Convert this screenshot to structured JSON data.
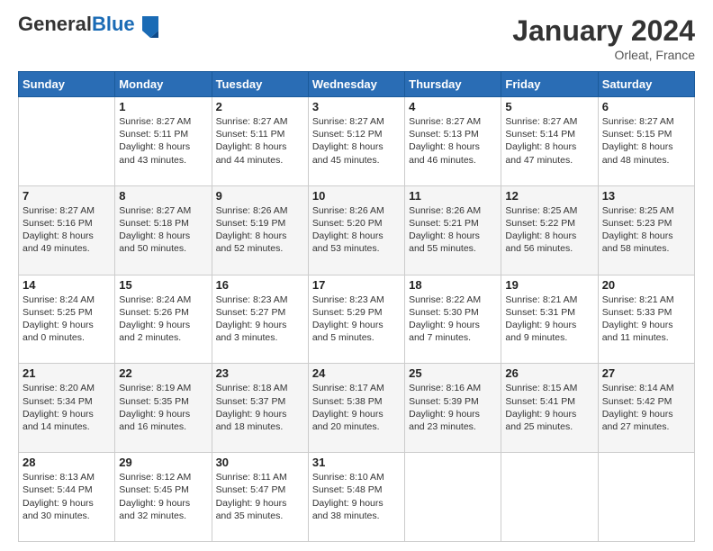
{
  "header": {
    "logo_general": "General",
    "logo_blue": "Blue",
    "month_title": "January 2024",
    "location": "Orleat, France"
  },
  "days_of_week": [
    "Sunday",
    "Monday",
    "Tuesday",
    "Wednesday",
    "Thursday",
    "Friday",
    "Saturday"
  ],
  "weeks": [
    [
      {
        "day": "",
        "text": ""
      },
      {
        "day": "1",
        "text": "Sunrise: 8:27 AM\nSunset: 5:11 PM\nDaylight: 8 hours\nand 43 minutes."
      },
      {
        "day": "2",
        "text": "Sunrise: 8:27 AM\nSunset: 5:11 PM\nDaylight: 8 hours\nand 44 minutes."
      },
      {
        "day": "3",
        "text": "Sunrise: 8:27 AM\nSunset: 5:12 PM\nDaylight: 8 hours\nand 45 minutes."
      },
      {
        "day": "4",
        "text": "Sunrise: 8:27 AM\nSunset: 5:13 PM\nDaylight: 8 hours\nand 46 minutes."
      },
      {
        "day": "5",
        "text": "Sunrise: 8:27 AM\nSunset: 5:14 PM\nDaylight: 8 hours\nand 47 minutes."
      },
      {
        "day": "6",
        "text": "Sunrise: 8:27 AM\nSunset: 5:15 PM\nDaylight: 8 hours\nand 48 minutes."
      }
    ],
    [
      {
        "day": "7",
        "text": "Sunrise: 8:27 AM\nSunset: 5:16 PM\nDaylight: 8 hours\nand 49 minutes."
      },
      {
        "day": "8",
        "text": "Sunrise: 8:27 AM\nSunset: 5:18 PM\nDaylight: 8 hours\nand 50 minutes."
      },
      {
        "day": "9",
        "text": "Sunrise: 8:26 AM\nSunset: 5:19 PM\nDaylight: 8 hours\nand 52 minutes."
      },
      {
        "day": "10",
        "text": "Sunrise: 8:26 AM\nSunset: 5:20 PM\nDaylight: 8 hours\nand 53 minutes."
      },
      {
        "day": "11",
        "text": "Sunrise: 8:26 AM\nSunset: 5:21 PM\nDaylight: 8 hours\nand 55 minutes."
      },
      {
        "day": "12",
        "text": "Sunrise: 8:25 AM\nSunset: 5:22 PM\nDaylight: 8 hours\nand 56 minutes."
      },
      {
        "day": "13",
        "text": "Sunrise: 8:25 AM\nSunset: 5:23 PM\nDaylight: 8 hours\nand 58 minutes."
      }
    ],
    [
      {
        "day": "14",
        "text": "Sunrise: 8:24 AM\nSunset: 5:25 PM\nDaylight: 9 hours\nand 0 minutes."
      },
      {
        "day": "15",
        "text": "Sunrise: 8:24 AM\nSunset: 5:26 PM\nDaylight: 9 hours\nand 2 minutes."
      },
      {
        "day": "16",
        "text": "Sunrise: 8:23 AM\nSunset: 5:27 PM\nDaylight: 9 hours\nand 3 minutes."
      },
      {
        "day": "17",
        "text": "Sunrise: 8:23 AM\nSunset: 5:29 PM\nDaylight: 9 hours\nand 5 minutes."
      },
      {
        "day": "18",
        "text": "Sunrise: 8:22 AM\nSunset: 5:30 PM\nDaylight: 9 hours\nand 7 minutes."
      },
      {
        "day": "19",
        "text": "Sunrise: 8:21 AM\nSunset: 5:31 PM\nDaylight: 9 hours\nand 9 minutes."
      },
      {
        "day": "20",
        "text": "Sunrise: 8:21 AM\nSunset: 5:33 PM\nDaylight: 9 hours\nand 11 minutes."
      }
    ],
    [
      {
        "day": "21",
        "text": "Sunrise: 8:20 AM\nSunset: 5:34 PM\nDaylight: 9 hours\nand 14 minutes."
      },
      {
        "day": "22",
        "text": "Sunrise: 8:19 AM\nSunset: 5:35 PM\nDaylight: 9 hours\nand 16 minutes."
      },
      {
        "day": "23",
        "text": "Sunrise: 8:18 AM\nSunset: 5:37 PM\nDaylight: 9 hours\nand 18 minutes."
      },
      {
        "day": "24",
        "text": "Sunrise: 8:17 AM\nSunset: 5:38 PM\nDaylight: 9 hours\nand 20 minutes."
      },
      {
        "day": "25",
        "text": "Sunrise: 8:16 AM\nSunset: 5:39 PM\nDaylight: 9 hours\nand 23 minutes."
      },
      {
        "day": "26",
        "text": "Sunrise: 8:15 AM\nSunset: 5:41 PM\nDaylight: 9 hours\nand 25 minutes."
      },
      {
        "day": "27",
        "text": "Sunrise: 8:14 AM\nSunset: 5:42 PM\nDaylight: 9 hours\nand 27 minutes."
      }
    ],
    [
      {
        "day": "28",
        "text": "Sunrise: 8:13 AM\nSunset: 5:44 PM\nDaylight: 9 hours\nand 30 minutes."
      },
      {
        "day": "29",
        "text": "Sunrise: 8:12 AM\nSunset: 5:45 PM\nDaylight: 9 hours\nand 32 minutes."
      },
      {
        "day": "30",
        "text": "Sunrise: 8:11 AM\nSunset: 5:47 PM\nDaylight: 9 hours\nand 35 minutes."
      },
      {
        "day": "31",
        "text": "Sunrise: 8:10 AM\nSunset: 5:48 PM\nDaylight: 9 hours\nand 38 minutes."
      },
      {
        "day": "",
        "text": ""
      },
      {
        "day": "",
        "text": ""
      },
      {
        "day": "",
        "text": ""
      }
    ]
  ]
}
